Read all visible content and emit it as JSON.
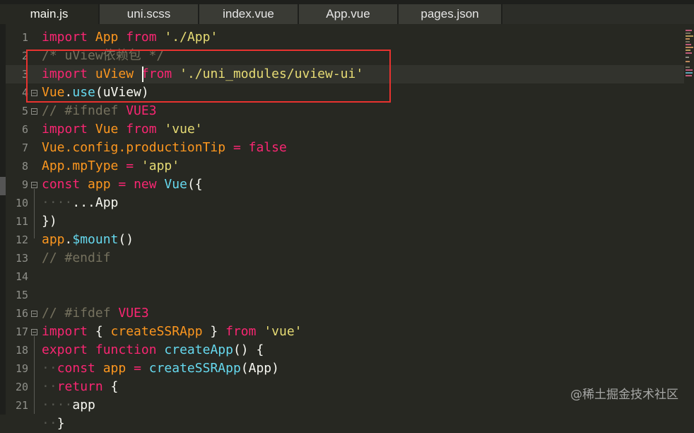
{
  "tabs": [
    {
      "label": "main.js",
      "active": true
    },
    {
      "label": "uni.scss",
      "active": false
    },
    {
      "label": "index.vue",
      "active": false
    },
    {
      "label": "App.vue",
      "active": false
    },
    {
      "label": "pages.json",
      "active": false
    }
  ],
  "line_numbers": [
    "1",
    "2",
    "3",
    "4",
    "5",
    "6",
    "7",
    "8",
    "9",
    "10",
    "11",
    "12",
    "13",
    "14",
    "15",
    "16",
    "17",
    "18",
    "19",
    "20",
    "21"
  ],
  "code": {
    "l1": {
      "kw1": "import",
      "id": "App",
      "kw2": "from",
      "str": "'./App'"
    },
    "l2": {
      "comment": "/* uView依赖包 */"
    },
    "l3": {
      "kw1": "import",
      "id": "uView",
      "kw2": "from",
      "str": "'./uni_modules/uview-ui'"
    },
    "l4": {
      "obj": "Vue",
      "dot": ".",
      "fn": "use",
      "args": "(uView)"
    },
    "l5": {
      "comment": "// #ifndef ",
      "flag": "VUE3"
    },
    "l6": {
      "kw1": "import",
      "id": "Vue",
      "kw2": "from",
      "str": "'vue'"
    },
    "l7": {
      "obj": "Vue",
      "p1": ".config.",
      "prop": "productionTip",
      "op": " = ",
      "val": "false"
    },
    "l8": {
      "obj": "App",
      "p1": ".",
      "prop": "mpType",
      "op": " = ",
      "str": "'app'"
    },
    "l9": {
      "kw": "const",
      "id": "app",
      "op": " = ",
      "kw2": "new",
      "fn": "Vue",
      "rest": "({"
    },
    "l10": {
      "dots": "····",
      "spread": "...App"
    },
    "l11": {
      "text": "})"
    },
    "l12": {
      "obj": "app",
      "dot": ".",
      "fn": "$mount",
      "rest": "()"
    },
    "l13": {
      "comment": "// #endif"
    },
    "l15": {
      "comment": "// #ifdef ",
      "flag": "VUE3"
    },
    "l16": {
      "kw1": "import",
      "open": " { ",
      "id": "createSSRApp",
      "close": " } ",
      "kw2": "from",
      "str": "'vue'"
    },
    "l17": {
      "kw": "export",
      "kw2": "function",
      "fn": "createApp",
      "rest": "() {"
    },
    "l18": {
      "dots": "··",
      "kw": "const",
      "id": "app",
      "op": " = ",
      "fn": "createSSRApp",
      "rest": "(App)"
    },
    "l19": {
      "dots": "··",
      "kw": "return",
      "rest": " {"
    },
    "l20": {
      "dots": "····",
      "id": "app"
    },
    "l21": {
      "dots": "··",
      "text": "}"
    }
  },
  "watermark": "@稀土掘金技术社区",
  "colors": {
    "background": "#272822",
    "keyword": "#f92672",
    "string": "#e6db74",
    "comment": "#75715e",
    "function": "#66d9ef",
    "variable": "#fd971f",
    "highlight_box": "#e8322f"
  }
}
